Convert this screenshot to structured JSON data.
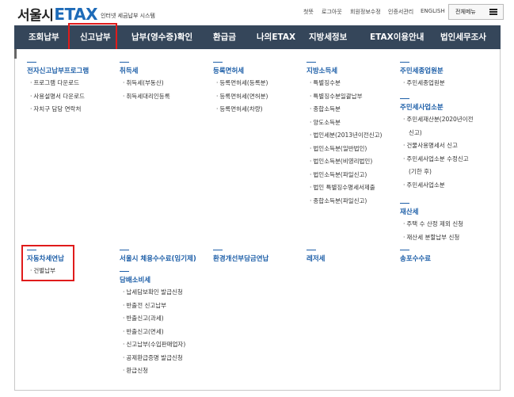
{
  "logo": {
    "seoul": "서울시",
    "etax": "ETAX",
    "subtitle": "인터넷 세금납부 시스템"
  },
  "util_links": [
    "첫뜻",
    "로그아웃",
    "회원정보수정",
    "인증서관리",
    "ENGLISH"
  ],
  "all_menu_label": "전체메뉴",
  "nav": [
    "조회납부",
    "신고납부",
    "납부(영수증)확인",
    "환급금",
    "나의ETAX",
    "지방세정보",
    "ETAX이용안내",
    "법인세무조사"
  ],
  "menu": {
    "col1": [
      {
        "title": "전자신고납부프로그램",
        "items": [
          "프로그램 다운로드",
          "사용설명서 다운로드",
          "자치구 담당 연락처"
        ]
      },
      {
        "title": "자동차세연납",
        "items": [
          "건별납부"
        ]
      }
    ],
    "col2": [
      {
        "title": "취득세",
        "items": [
          "취득세(부동산)",
          "취득세대리인등록"
        ]
      },
      {
        "title": "서울시 체용수수료(임기제)",
        "items": []
      },
      {
        "title": "담배소비세",
        "items": [
          "납세담보확인 발급신청",
          "반출전 신고납부",
          "반출신고(과세)",
          "반출신고(면세)",
          "신고납부(수입판매업자)",
          "공제환급증명 발급신청",
          "환급신청"
        ]
      }
    ],
    "col3": [
      {
        "title": "등록면허세",
        "items": [
          "등록면허세(등록분)",
          "등록면허세(면허분)",
          "등록면허세(차량)"
        ]
      },
      {
        "title": "환경개선부담금연납",
        "items": []
      }
    ],
    "col4": [
      {
        "title": "지방소득세",
        "items": [
          "특별징수분",
          "특별징수분일괄납부",
          "종합소득분",
          "양도소득분",
          "법인세분(2013년이전신고)",
          "법인소득분(일반법인)",
          "법인소득분(비영리법인)",
          "법인소득분(파일신고)",
          "법인 특별징수명세서제출",
          "종합소득분(파일신고)"
        ]
      },
      {
        "title": "레저세",
        "items": []
      }
    ],
    "col5": [
      {
        "title": "주민세종업원분",
        "items": [
          "주민세종업원분"
        ]
      },
      {
        "title": "주민세사업소분",
        "items": [
          "주민세재산분(2020년이전",
          "신고)",
          "건물사용명세서 신고",
          "주민세사업소분 수정신고",
          "(기한 후)",
          "주민세사업소분"
        ]
      },
      {
        "title": "재산세",
        "items": [
          "주택 수 산정 제외 신청",
          "재산세 분할납부 신청"
        ]
      },
      {
        "title": "송포수수료",
        "items": []
      }
    ]
  }
}
